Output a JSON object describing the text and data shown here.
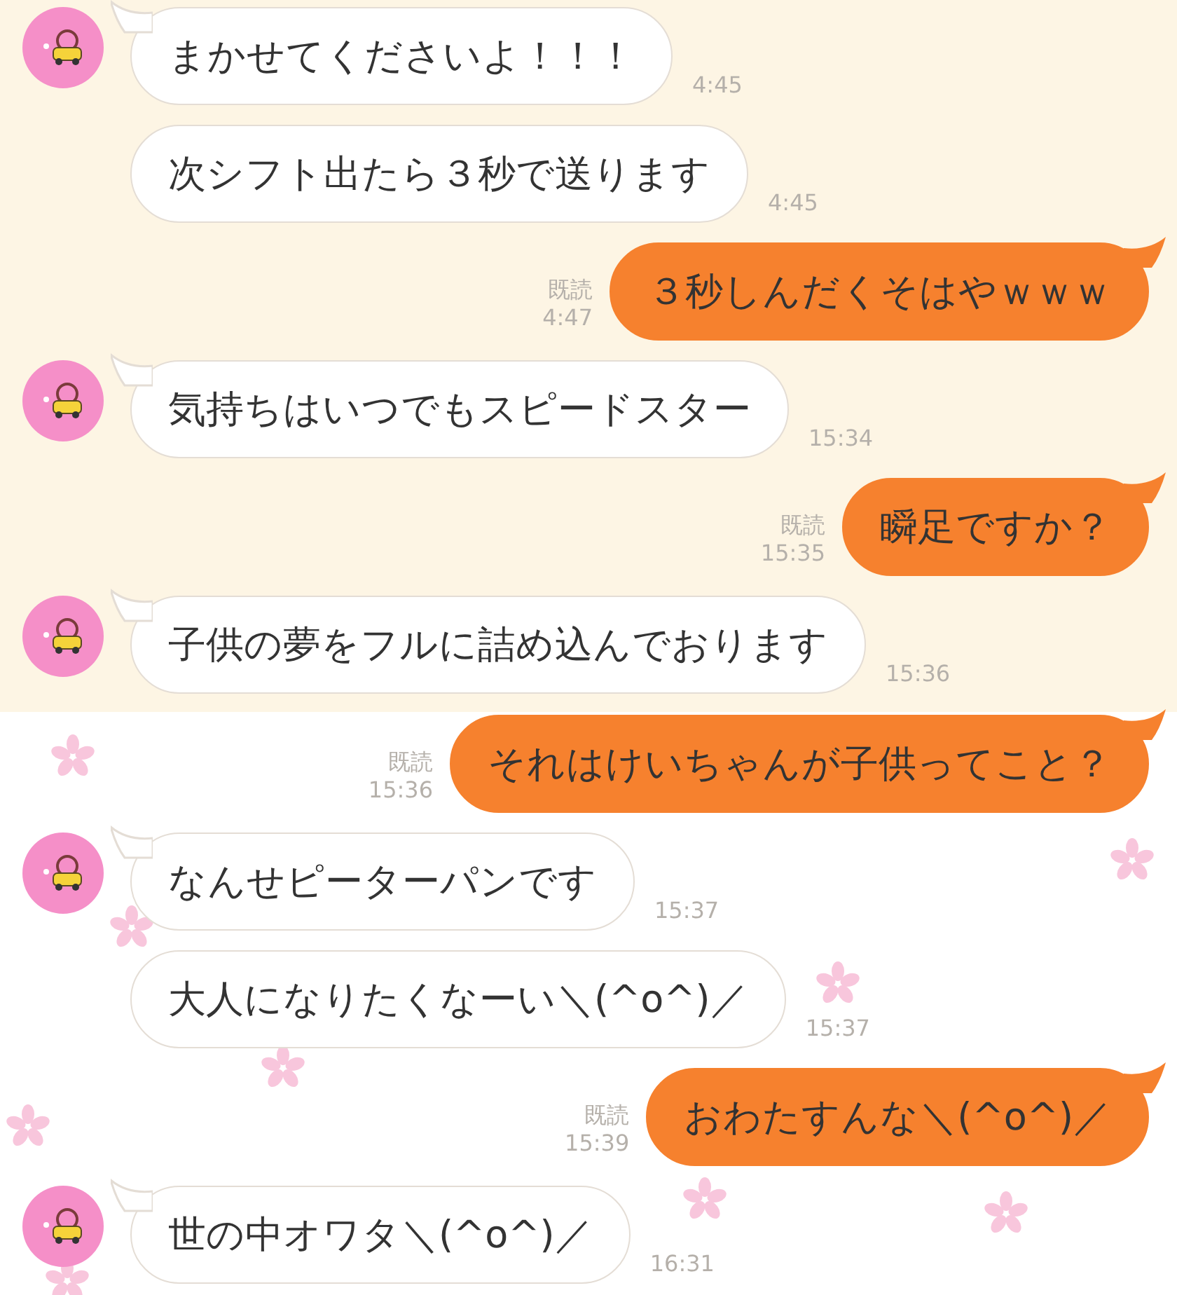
{
  "sections": [
    {
      "kind": "cream",
      "messages": [
        {
          "kind": "received",
          "avatar": true,
          "text": "まかせてくださいよ！！！",
          "time": "4:45"
        },
        {
          "kind": "received",
          "avatar": false,
          "text": "次シフト出たら３秒で送ります",
          "time": "4:45"
        },
        {
          "kind": "sent",
          "read": "既読",
          "text": "３秒しんだくそはやｗｗｗ",
          "time": "4:47"
        },
        {
          "kind": "received",
          "avatar": true,
          "text": "気持ちはいつでもスピードスター",
          "time": "15:34"
        },
        {
          "kind": "sent",
          "read": "既読",
          "text": "瞬足ですか？",
          "time": "15:35"
        },
        {
          "kind": "received",
          "avatar": true,
          "text": "子供の夢をフルに詰め込んでおります",
          "time": "15:36"
        }
      ]
    },
    {
      "kind": "flowers",
      "messages": [
        {
          "kind": "sent",
          "read": "既読",
          "text": "それはけいちゃんが子供ってこと？",
          "time": "15:36"
        },
        {
          "kind": "received",
          "avatar": true,
          "text": "なんせピーターパンです",
          "time": "15:37"
        },
        {
          "kind": "received",
          "avatar": false,
          "text": "大人になりたくなーい＼(^o^)／",
          "time": "15:37"
        },
        {
          "kind": "sent",
          "read": "既読",
          "text": "おわたすんな＼(^o^)／",
          "time": "15:39"
        },
        {
          "kind": "received",
          "avatar": true,
          "text": "世の中オワタ＼(^o^)／",
          "time": "16:31"
        }
      ]
    }
  ]
}
